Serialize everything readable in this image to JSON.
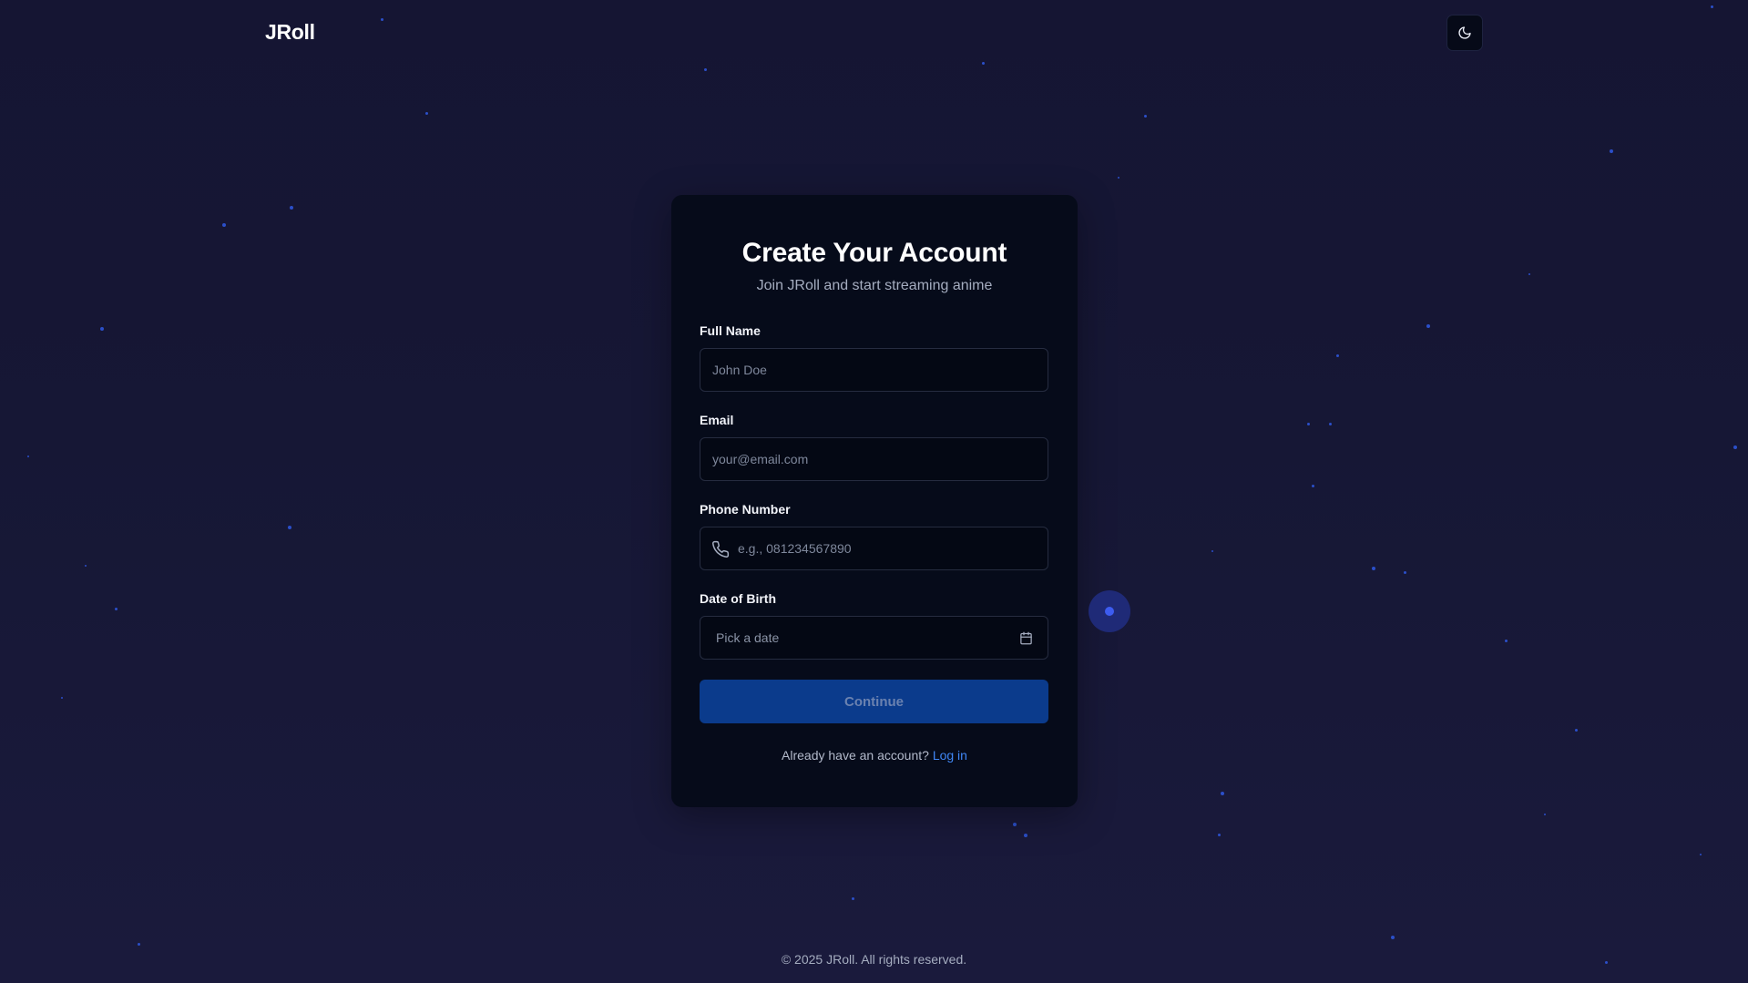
{
  "app": {
    "logo": "JRoll"
  },
  "header": {
    "theme_toggle_icon": "moon-icon"
  },
  "signup": {
    "title": "Create Your Account",
    "subtitle": "Join JRoll and start streaming anime",
    "fields": {
      "full_name": {
        "label": "Full Name",
        "placeholder": "John Doe",
        "value": ""
      },
      "email": {
        "label": "Email",
        "placeholder": "your@email.com",
        "value": ""
      },
      "phone": {
        "label": "Phone Number",
        "placeholder": "e.g., 081234567890",
        "value": "",
        "icon": "phone-icon"
      },
      "dob": {
        "label": "Date of Birth",
        "placeholder": "Pick a date",
        "icon": "calendar-icon"
      }
    },
    "continue_label": "Continue",
    "login_prompt": "Already have an account?",
    "login_link": "Log in"
  },
  "footer": {
    "copyright": "© 2025 JRoll. All rights reserved."
  },
  "colors": {
    "background": "#161735",
    "card": "#060b1a",
    "accent": "#0b3b8c",
    "link": "#3f86f4"
  }
}
